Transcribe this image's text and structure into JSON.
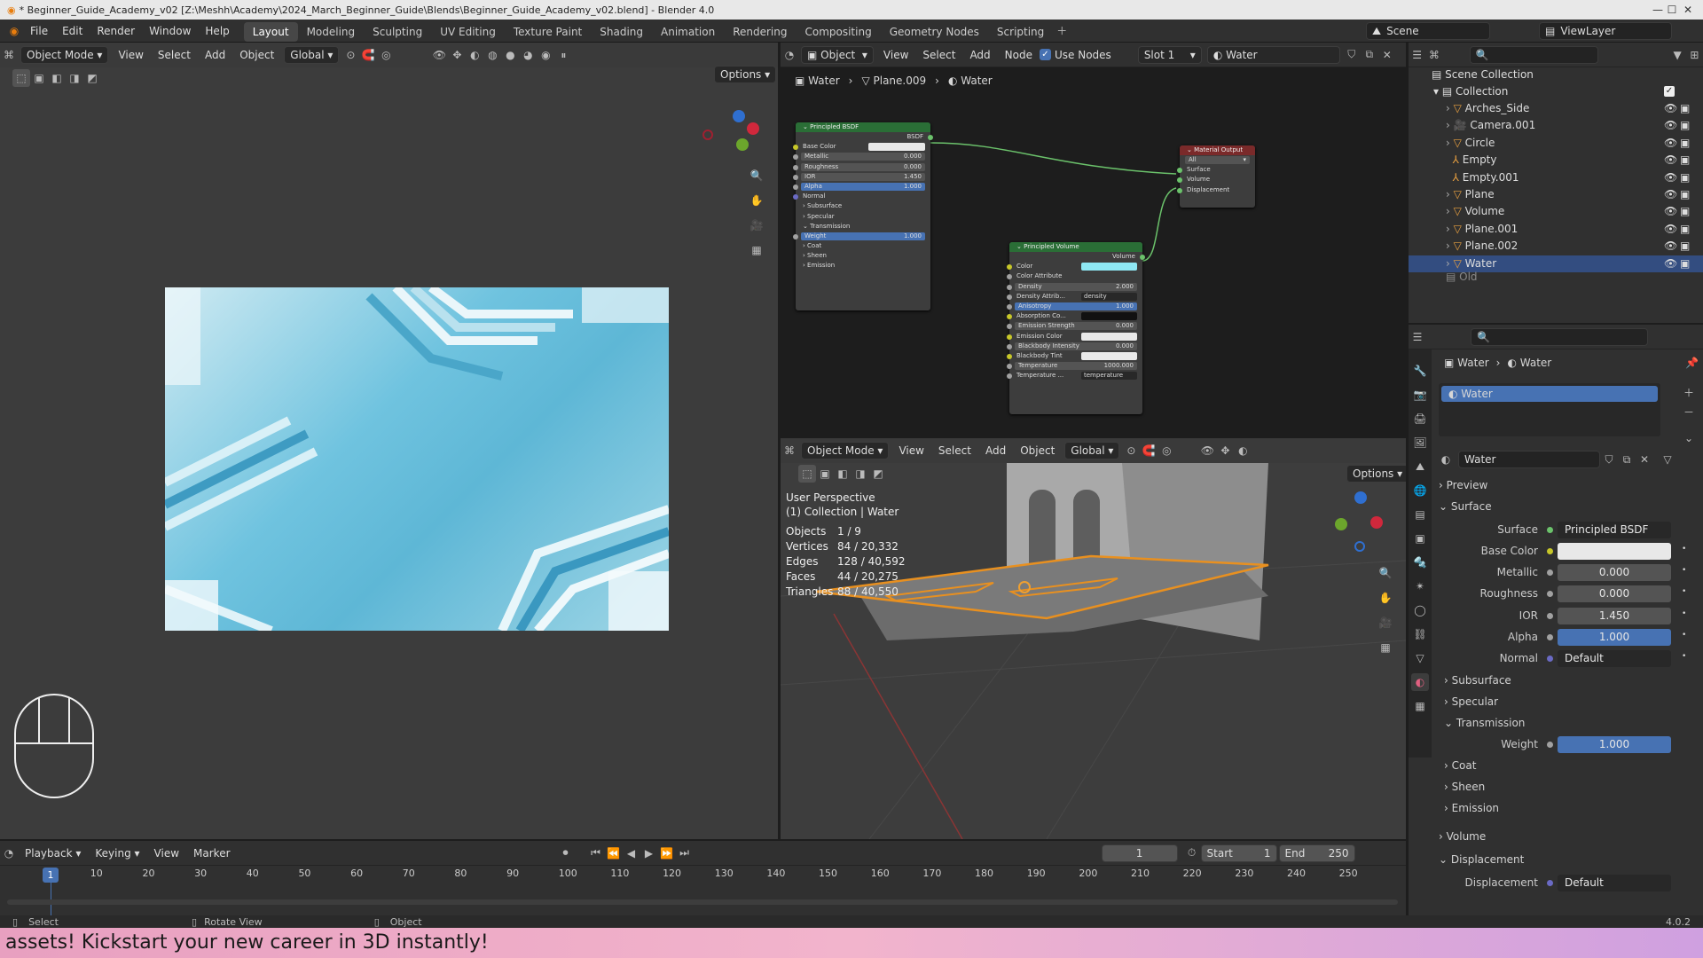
{
  "window": {
    "title": "* Beginner_Guide_Academy_v02 [Z:\\Meshh\\Academy\\2024_March_Beginner_Guide\\Blends\\Beginner_Guide_Academy_v02.blend] - Blender 4.0"
  },
  "menu": [
    "File",
    "Edit",
    "Render",
    "Window",
    "Help"
  ],
  "workspaces": [
    "Layout",
    "Modeling",
    "Sculpting",
    "UV Editing",
    "Texture Paint",
    "Shading",
    "Animation",
    "Rendering",
    "Compositing",
    "Geometry Nodes",
    "Scripting"
  ],
  "scene": "Scene",
  "viewlayer": "ViewLayer",
  "left_header": {
    "mode": "Object Mode",
    "view": "View",
    "select": "Select",
    "add": "Add",
    "object": "Object",
    "orient": "Global",
    "options": "Options"
  },
  "node_header": {
    "type": "Object",
    "view": "View",
    "select": "Select",
    "add": "Add",
    "node": "Node",
    "use_nodes": "Use Nodes",
    "slot": "Slot 1",
    "material": "Water"
  },
  "breadcrumb": {
    "a": "Water",
    "b": "Plane.009",
    "c": "Water"
  },
  "bsdf": {
    "title": "Principled BSDF",
    "out": "BSDF",
    "rows": [
      {
        "l": "Base Color",
        "v": "",
        "t": "color"
      },
      {
        "l": "Metallic",
        "v": "0.000",
        "t": "field"
      },
      {
        "l": "Roughness",
        "v": "0.000",
        "t": "field"
      },
      {
        "l": "IOR",
        "v": "1.450",
        "t": "field"
      },
      {
        "l": "Alpha",
        "v": "1.000",
        "t": "blue"
      },
      {
        "l": "Normal",
        "v": "",
        "t": "text"
      },
      {
        "l": "Subsurface",
        "v": "",
        "t": "sect"
      },
      {
        "l": "Specular",
        "v": "",
        "t": "sect"
      },
      {
        "l": "Transmission",
        "v": "",
        "t": "sectopen"
      },
      {
        "l": "Weight",
        "v": "1.000",
        "t": "blue"
      },
      {
        "l": "Coat",
        "v": "",
        "t": "sect"
      },
      {
        "l": "Sheen",
        "v": "",
        "t": "sect"
      },
      {
        "l": "Emission",
        "v": "",
        "t": "sect"
      }
    ]
  },
  "volume": {
    "title": "Principled Volume",
    "out": "Volume",
    "rows": [
      {
        "l": "Color",
        "v": "",
        "t": "cyan"
      },
      {
        "l": "Color Attribute",
        "v": "",
        "t": "text"
      },
      {
        "l": "Density",
        "v": "2.000",
        "t": "field"
      },
      {
        "l": "Density Attrib...",
        "v": "density",
        "t": "dark"
      },
      {
        "l": "Anisotropy",
        "v": "1.000",
        "t": "blue"
      },
      {
        "l": "Absorption Co...",
        "v": "",
        "t": "black"
      },
      {
        "l": "Emission Strength",
        "v": "0.000",
        "t": "field"
      },
      {
        "l": "Emission Color",
        "v": "",
        "t": "color"
      },
      {
        "l": "Blackbody Intensity",
        "v": "0.000",
        "t": "field"
      },
      {
        "l": "Blackbody Tint",
        "v": "",
        "t": "color"
      },
      {
        "l": "Temperature",
        "v": "1000.000",
        "t": "field"
      },
      {
        "l": "Temperature ...",
        "v": "temperature",
        "t": "dark"
      }
    ]
  },
  "matout": {
    "title": "Material Output",
    "target": "All",
    "rows": [
      "Surface",
      "Volume",
      "Displacement"
    ]
  },
  "viewport3d": {
    "mode": "Object Mode",
    "view": "View",
    "select": "Select",
    "add": "Add",
    "object": "Object",
    "orient": "Global",
    "options": "Options",
    "persp": "User Perspective",
    "coll": "(1) Collection | Water",
    "stats": [
      {
        "k": "Objects",
        "v": "1 / 9"
      },
      {
        "k": "Vertices",
        "v": "84 / 20,332"
      },
      {
        "k": "Edges",
        "v": "128 / 40,592"
      },
      {
        "k": "Faces",
        "v": "44 / 20,275"
      },
      {
        "k": "Triangles",
        "v": "88 / 40,550"
      }
    ]
  },
  "outliner": {
    "root": "Scene Collection",
    "coll": "Collection",
    "items": [
      "Arches_Side",
      "Camera.001",
      "Circle",
      "Empty",
      "Empty.001",
      "Plane",
      "Volume",
      "Plane.001",
      "Plane.002",
      "Water"
    ],
    "old": "Old"
  },
  "props": {
    "crumb_a": "Water",
    "crumb_b": "Water",
    "slot": "Water",
    "mat": "Water",
    "preview": "Preview",
    "surface_sect": "Surface",
    "surface_lbl": "Surface",
    "surface_val": "Principled BSDF",
    "rows": [
      {
        "l": "Base Color",
        "v": "",
        "t": "white"
      },
      {
        "l": "Metallic",
        "v": "0.000",
        "t": "grey"
      },
      {
        "l": "Roughness",
        "v": "0.000",
        "t": "grey"
      },
      {
        "l": "IOR",
        "v": "1.450",
        "t": "grey"
      },
      {
        "l": "Alpha",
        "v": "1.000",
        "t": "blue"
      },
      {
        "l": "Normal",
        "v": "Default",
        "t": "dark"
      }
    ],
    "subs": [
      "Subsurface",
      "Specular",
      "Transmission"
    ],
    "weight_l": "Weight",
    "weight_v": "1.000",
    "subs2": [
      "Coat",
      "Sheen",
      "Emission"
    ],
    "volume": "Volume",
    "displacement": "Displacement",
    "disp_l": "Displacement",
    "disp_v": "Default"
  },
  "timeline": {
    "playback": "Playback",
    "keying": "Keying",
    "view": "View",
    "marker": "Marker",
    "frame": "1",
    "start_l": "Start",
    "start": "1",
    "end_l": "End",
    "end": "250",
    "ticks": [
      "1",
      "10",
      "20",
      "30",
      "40",
      "50",
      "60",
      "70",
      "80",
      "90",
      "100",
      "110",
      "120",
      "130",
      "140",
      "150",
      "160",
      "170",
      "180",
      "190",
      "200",
      "210",
      "220",
      "230",
      "240",
      "250"
    ]
  },
  "status": {
    "select": "Select",
    "rotate": "Rotate View",
    "object": "Object",
    "version": "4.0.2"
  },
  "banner": "assets! Kickstart your new career in 3D instantly!"
}
